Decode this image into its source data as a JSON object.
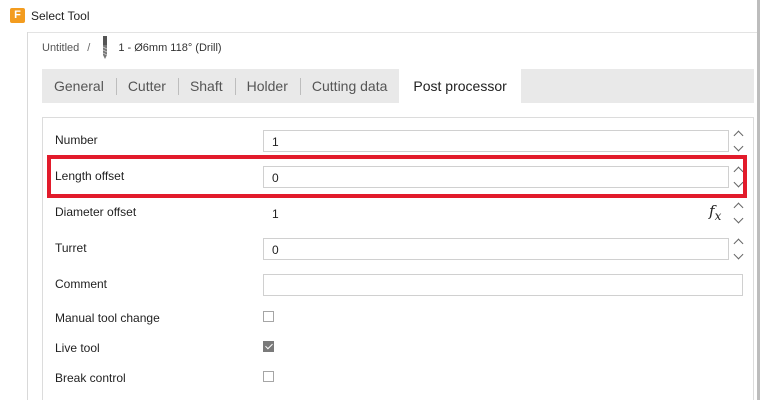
{
  "window": {
    "title": "Select Tool",
    "logo_letter": "F"
  },
  "breadcrumb": {
    "root": "Untitled",
    "separator": "/",
    "tool": "1 - Ø6mm 118° (Drill)"
  },
  "tabs": [
    {
      "label": "General",
      "active": false
    },
    {
      "label": "Cutter",
      "active": false
    },
    {
      "label": "Shaft",
      "active": false
    },
    {
      "label": "Holder",
      "active": false
    },
    {
      "label": "Cutting data",
      "active": false
    },
    {
      "label": "Post processor",
      "active": true
    }
  ],
  "fields": {
    "number": {
      "label": "Number",
      "value": "1"
    },
    "length_offset": {
      "label": "Length offset",
      "value": "0"
    },
    "diameter_offset": {
      "label": "Diameter offset",
      "value": "1"
    },
    "turret": {
      "label": "Turret",
      "value": "0"
    },
    "comment": {
      "label": "Comment",
      "value": ""
    },
    "manual_tool_change": {
      "label": "Manual tool change",
      "checked": false
    },
    "live_tool": {
      "label": "Live tool",
      "checked": true
    },
    "break_control": {
      "label": "Break control",
      "checked": false
    }
  },
  "fx_symbol": {
    "f": "f",
    "x": "x"
  },
  "colors": {
    "highlight": "#e21b2b",
    "logo": "#f39c1f",
    "tab_bar": "#e9e9e9"
  }
}
